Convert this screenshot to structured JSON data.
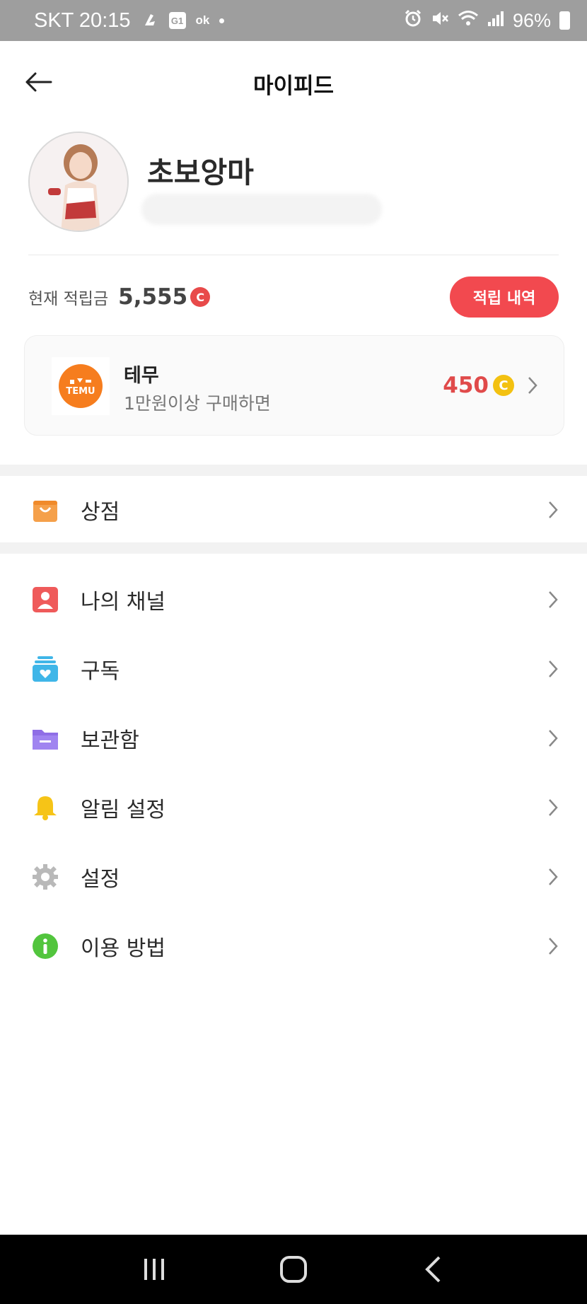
{
  "status_bar": {
    "carrier_time": "SKT 20:15",
    "box_icon_text": "G1",
    "ok_text": "ok",
    "battery": "96%"
  },
  "header": {
    "title": "마이피드"
  },
  "profile": {
    "nickname": "초보앙마"
  },
  "points": {
    "label": "현재 적립금",
    "value": "5,555",
    "coin_symbol": "C",
    "history_button": "적립 내역"
  },
  "offer": {
    "logo_text": "TEMU",
    "title": "테무",
    "description": "1만원이상 구매하면",
    "reward": "450",
    "coin_symbol": "C"
  },
  "menu": {
    "shop": {
      "label": "상점",
      "icon": "shopping-bag-icon",
      "color": "#f5a04a"
    },
    "items": [
      {
        "label": "나의 채널",
        "icon": "person-icon",
        "color": "#ef5a5a"
      },
      {
        "label": "구독",
        "icon": "subscribe-heart-icon",
        "color": "#3fb6e8"
      },
      {
        "label": "보관함",
        "icon": "folder-icon",
        "color": "#8f6ee6"
      },
      {
        "label": "알림 설정",
        "icon": "bell-icon",
        "color": "#f6c417"
      },
      {
        "label": "설정",
        "icon": "gear-icon",
        "color": "#b9b9b9"
      },
      {
        "label": "이용 방법",
        "icon": "info-icon",
        "color": "#52c53d"
      }
    ]
  },
  "colors": {
    "accent_red": "#f2494f",
    "status_bar": "#9e9e9e",
    "nav_bar": "#000000"
  }
}
